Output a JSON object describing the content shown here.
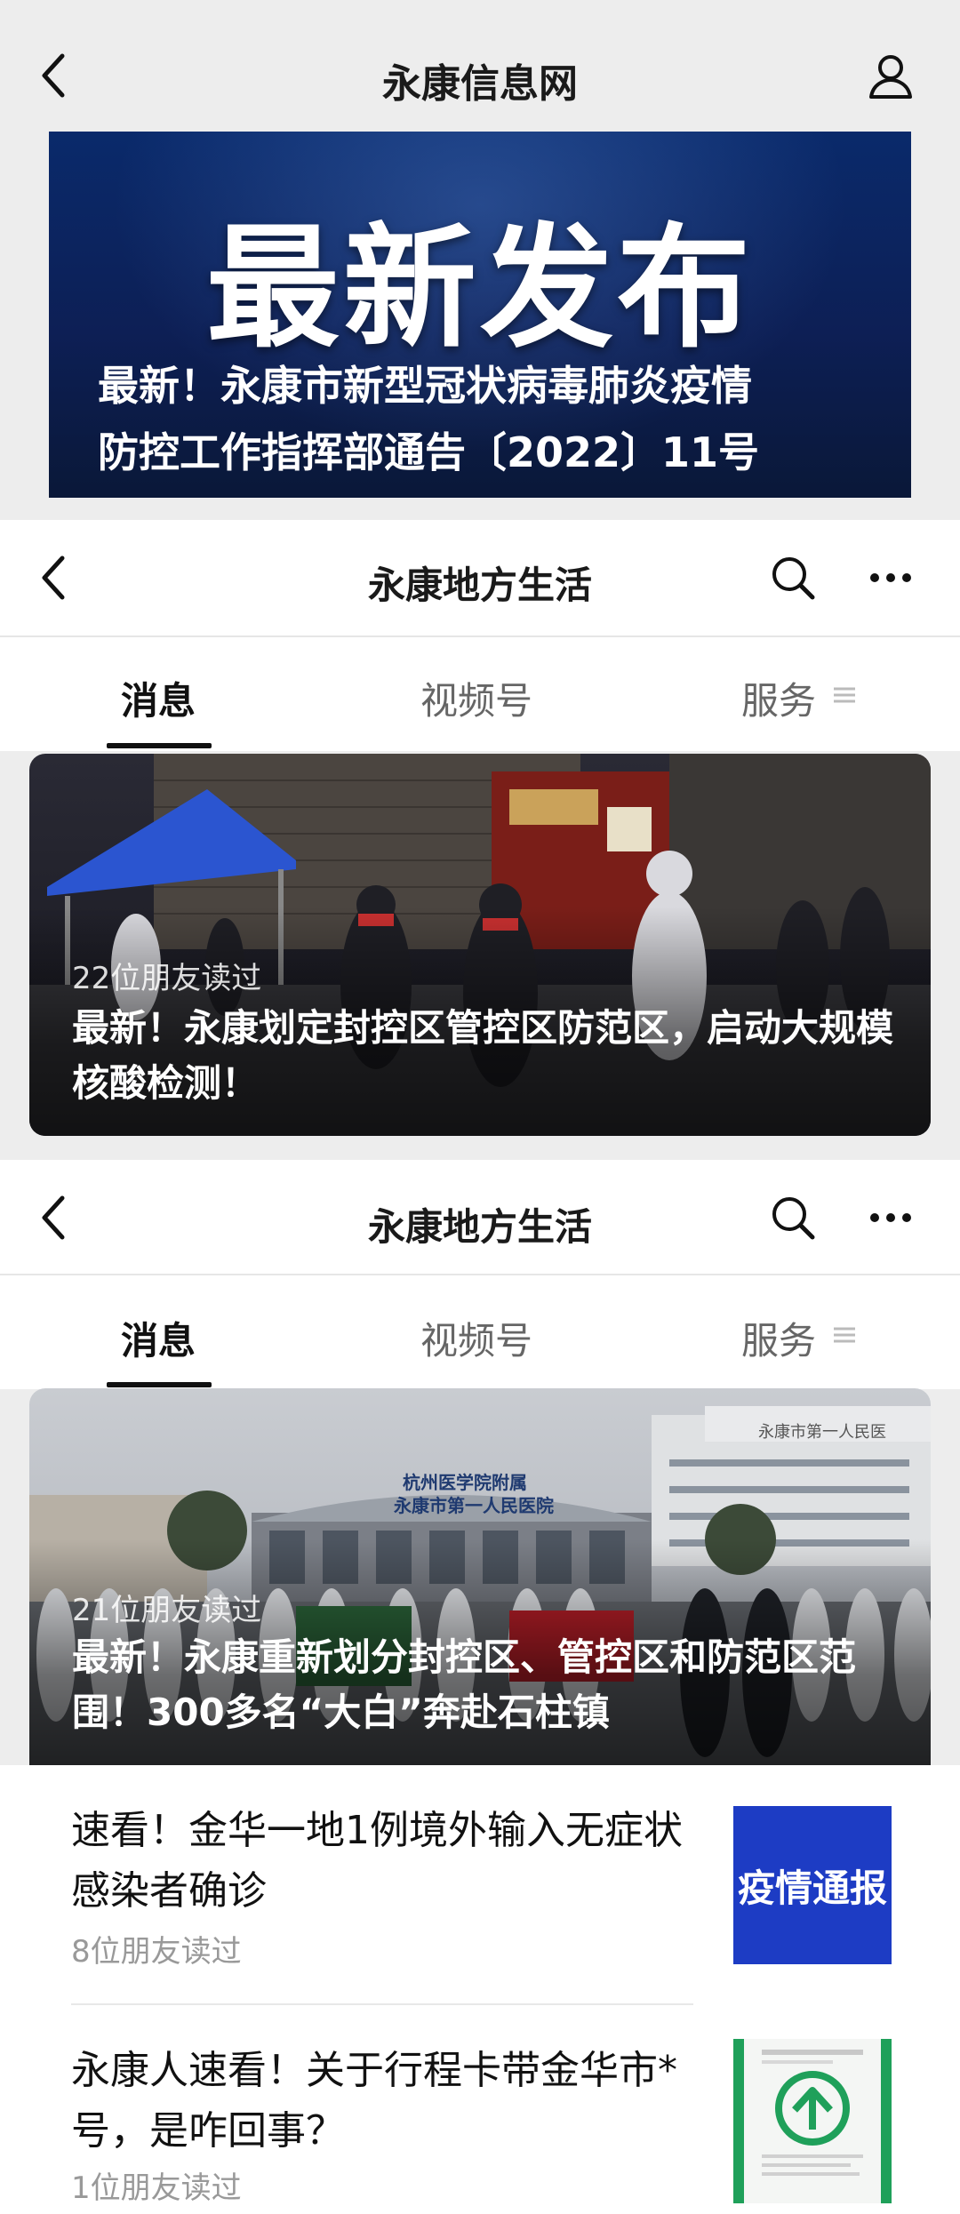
{
  "section1": {
    "title": "永康信息网",
    "banner_headline": "最新发布",
    "banner_line1": "最新！永康市新型冠状病毒肺炎疫情",
    "banner_line2": "防控工作指挥部通告〔2022〕11号"
  },
  "section2": {
    "title": "永康地方生活",
    "tabs": [
      "消息",
      "视频号",
      "服务"
    ],
    "article": {
      "readers": "22位朋友读过",
      "headline": "最新！永康划定封控区管控区防范区，启动大规模核酸检测！"
    }
  },
  "section3": {
    "title": "永康地方生活",
    "tabs": [
      "消息",
      "视频号",
      "服务"
    ],
    "article": {
      "readers": "21位朋友读过",
      "headline": "最新！永康重新划分封控区、管控区和防范区范围！300多名“大白”奔赴石柱镇",
      "sign_line1": "杭州医学院附属",
      "sign_line2": "永康市第一人民医院",
      "building_sign": "永康市第一人民医"
    },
    "list": [
      {
        "title": "速看！金华一地1例境外输入无症状感染者确诊",
        "readers": "8位朋友读过",
        "thumb_text": "疫情通报"
      },
      {
        "title": "永康人速看！关于行程卡带金华市*号，是咋回事？",
        "readers": "1位朋友读过"
      }
    ]
  },
  "colors": {
    "banner_bg": "#0d1f55",
    "thumb_blue": "#1d3cc4",
    "green_arrow": "#1fa05a"
  },
  "icons": [
    "back-icon",
    "user-icon",
    "search-icon",
    "more-icon",
    "menu-lines-icon"
  ]
}
